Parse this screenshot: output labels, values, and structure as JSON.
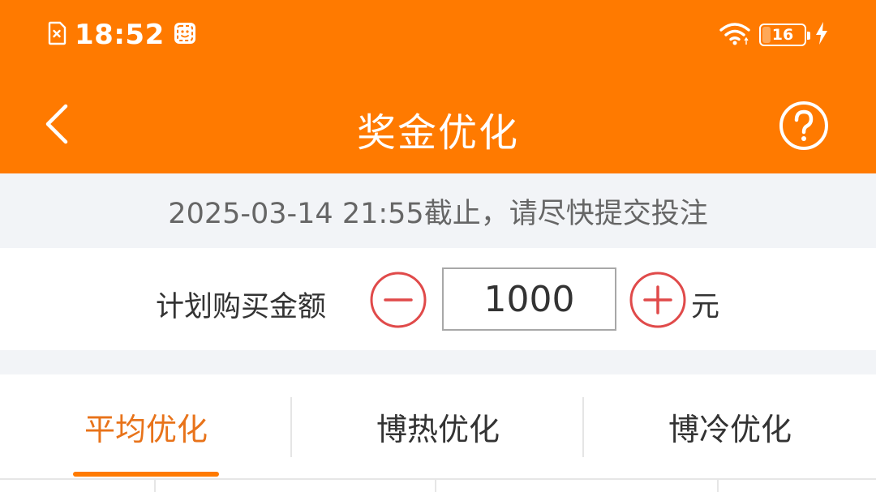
{
  "status_bar": {
    "time": "18:52",
    "battery_level": "16",
    "icons": [
      "sim-error-icon",
      "face-icon",
      "wifi-icon",
      "battery-icon",
      "charging-icon"
    ]
  },
  "nav": {
    "title": "奖金优化",
    "icons": [
      "back-chevron-icon",
      "help-icon"
    ]
  },
  "deadline": {
    "text": "2025-03-14 21:55截止，请尽快提交投注"
  },
  "amount": {
    "label": "计划购买金额",
    "value": "1000",
    "unit": "元"
  },
  "tabs": [
    {
      "label": "平均优化",
      "active": true
    },
    {
      "label": "博热优化",
      "active": false
    },
    {
      "label": "博冷优化",
      "active": false
    }
  ],
  "colors": {
    "brand": "#ff7a00",
    "active_tab_text": "#e8731a",
    "stepper_red": "#e04a4a",
    "banner_bg": "#f2f4f7"
  }
}
